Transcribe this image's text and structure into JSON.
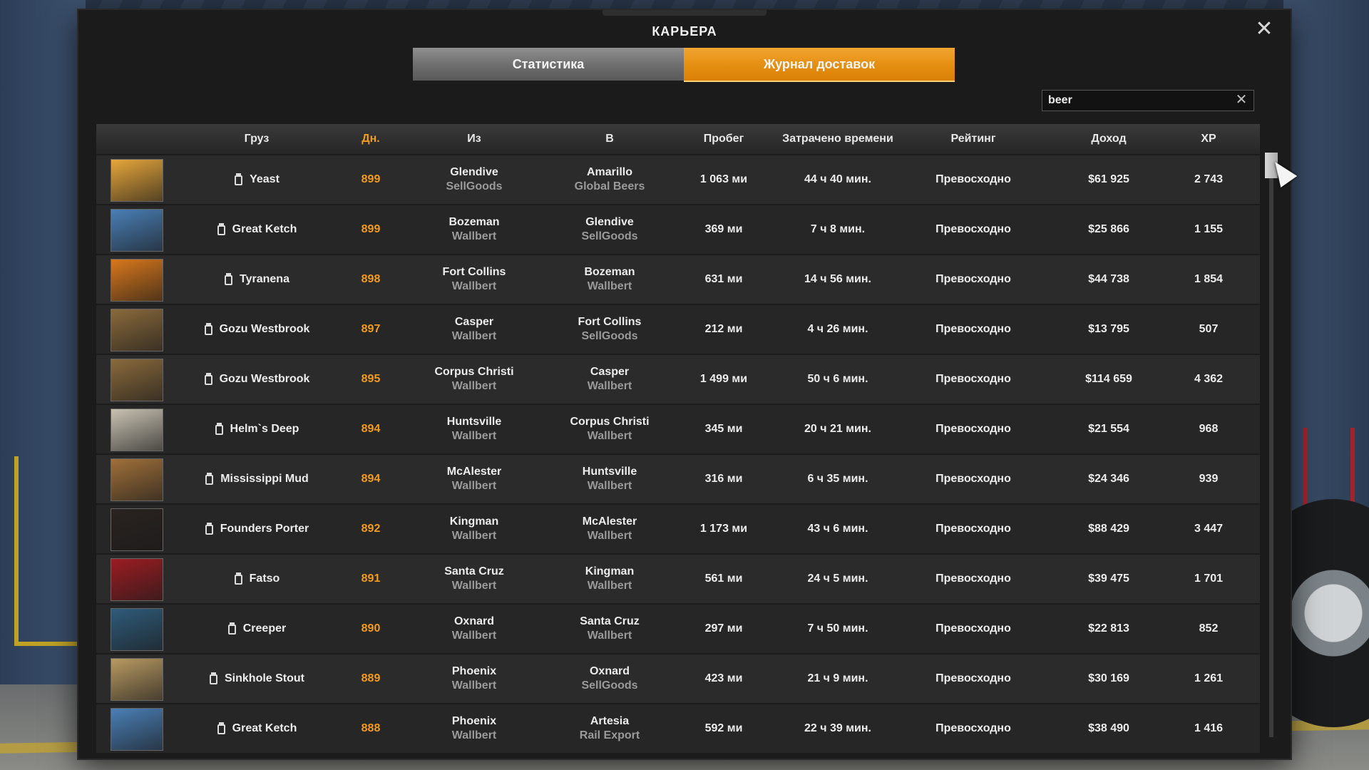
{
  "window": {
    "title": "КАРЬЕРА"
  },
  "tabs": [
    {
      "label": "Статистика",
      "active": false
    },
    {
      "label": "Журнал доставок",
      "active": true
    }
  ],
  "search": {
    "value": "beer",
    "placeholder": ""
  },
  "columns": {
    "cargo": "Груз",
    "days": "Дн.",
    "from": "Из",
    "to": "В",
    "distance": "Пробег",
    "time": "Затрачено времени",
    "rating": "Рейтинг",
    "income": "Доход",
    "xp": "XP"
  },
  "colors": {
    "accent": "#f29b1e",
    "panel": "#1b1b1b",
    "row": "#2b2b2b"
  },
  "rows": [
    {
      "cargo": "Yeast",
      "day": "899",
      "from_city": "Glendive",
      "from_company": "SellGoods",
      "to_city": "Amarillo",
      "to_company": "Global Beers",
      "distance": "1 063 ми",
      "time": "44 ч 40 мин.",
      "rating": "Превосходно",
      "income": "$61 925",
      "xp": "2 743",
      "thumb": "#e6a63b"
    },
    {
      "cargo": "Great Ketch",
      "day": "899",
      "from_city": "Bozeman",
      "from_company": "Wallbert",
      "to_city": "Glendive",
      "to_company": "SellGoods",
      "distance": "369 ми",
      "time": "7 ч 8 мин.",
      "rating": "Превосходно",
      "income": "$25 866",
      "xp": "1 155",
      "thumb": "#4a7fb6"
    },
    {
      "cargo": "Tyranena",
      "day": "898",
      "from_city": "Fort Collins",
      "from_company": "Wallbert",
      "to_city": "Bozeman",
      "to_company": "Wallbert",
      "distance": "631 ми",
      "time": "14 ч 56 мин.",
      "rating": "Превосходно",
      "income": "$44 738",
      "xp": "1 854",
      "thumb": "#d9781c"
    },
    {
      "cargo": "Gozu Westbrook",
      "day": "897",
      "from_city": "Casper",
      "from_company": "Wallbert",
      "to_city": "Fort Collins",
      "to_company": "SellGoods",
      "distance": "212 ми",
      "time": "4 ч 26 мин.",
      "rating": "Превосходно",
      "income": "$13 795",
      "xp": "507",
      "thumb": "#8a6a3c"
    },
    {
      "cargo": "Gozu Westbrook",
      "day": "895",
      "from_city": "Corpus Christi",
      "from_company": "Wallbert",
      "to_city": "Casper",
      "to_company": "Wallbert",
      "distance": "1 499 ми",
      "time": "50 ч 6 мин.",
      "rating": "Превосходно",
      "income": "$114 659",
      "xp": "4 362",
      "thumb": "#8a6a3c"
    },
    {
      "cargo": "Helm`s Deep",
      "day": "894",
      "from_city": "Huntsville",
      "from_company": "Wallbert",
      "to_city": "Corpus Christi",
      "to_company": "Wallbert",
      "distance": "345 ми",
      "time": "20 ч 21 мин.",
      "rating": "Превосходно",
      "income": "$21 554",
      "xp": "968",
      "thumb": "#c9c2b2"
    },
    {
      "cargo": "Mississippi Mud",
      "day": "894",
      "from_city": "McAlester",
      "from_company": "Wallbert",
      "to_city": "Huntsville",
      "to_company": "Wallbert",
      "distance": "316 ми",
      "time": "6 ч 35 мин.",
      "rating": "Превосходно",
      "income": "$24 346",
      "xp": "939",
      "thumb": "#a0703a"
    },
    {
      "cargo": "Founders Porter",
      "day": "892",
      "from_city": "Kingman",
      "from_company": "Wallbert",
      "to_city": "McAlester",
      "to_company": "Wallbert",
      "distance": "1 173 ми",
      "time": "43 ч 6 мин.",
      "rating": "Превосходно",
      "income": "$88 429",
      "xp": "3 447",
      "thumb": "#2a2320"
    },
    {
      "cargo": "Fatso",
      "day": "891",
      "from_city": "Santa Cruz",
      "from_company": "Wallbert",
      "to_city": "Kingman",
      "to_company": "Wallbert",
      "distance": "561 ми",
      "time": "24 ч 5 мин.",
      "rating": "Превосходно",
      "income": "$39 475",
      "xp": "1 701",
      "thumb": "#9b1c22"
    },
    {
      "cargo": "Creeper",
      "day": "890",
      "from_city": "Oxnard",
      "from_company": "Wallbert",
      "to_city": "Santa Cruz",
      "to_company": "Wallbert",
      "distance": "297 ми",
      "time": "7 ч 50 мин.",
      "rating": "Превосходно",
      "income": "$22 813",
      "xp": "852",
      "thumb": "#2f5b7a"
    },
    {
      "cargo": "Sinkhole Stout",
      "day": "889",
      "from_city": "Phoenix",
      "from_company": "Wallbert",
      "to_city": "Oxnard",
      "to_company": "SellGoods",
      "distance": "423 ми",
      "time": "21 ч 9 мин.",
      "rating": "Превосходно",
      "income": "$30 169",
      "xp": "1 261",
      "thumb": "#b89a62"
    },
    {
      "cargo": "Great Ketch",
      "day": "888",
      "from_city": "Phoenix",
      "from_company": "Wallbert",
      "to_city": "Artesia",
      "to_company": "Rail Export",
      "distance": "592 ми",
      "time": "22 ч 39 мин.",
      "rating": "Превосходно",
      "income": "$38 490",
      "xp": "1 416",
      "thumb": "#4a7fb6"
    }
  ]
}
